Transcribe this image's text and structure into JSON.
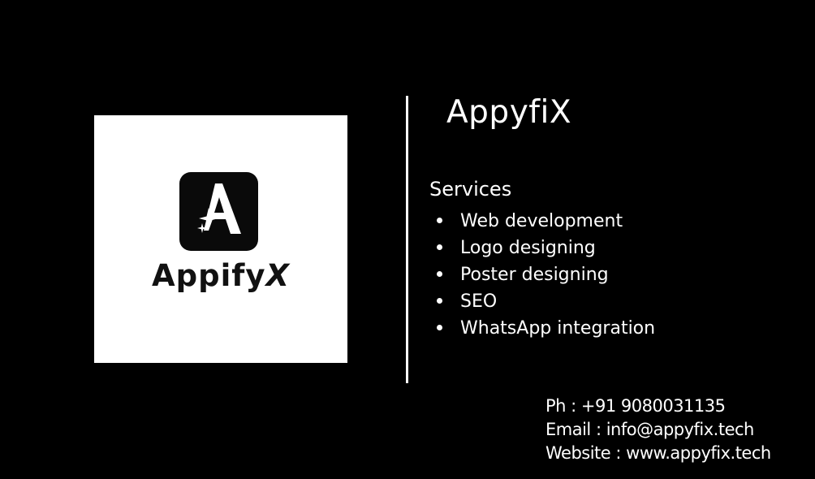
{
  "card": {
    "company_name": "AppyfiX",
    "background_color": "#000000",
    "text_color": "#ffffff"
  },
  "logo": {
    "wordmark_main": "Appify",
    "wordmark_x": "X",
    "tile_letter": "A",
    "icon": "sparkle-icon"
  },
  "services": {
    "heading": "Services",
    "items": [
      "Web development",
      "Logo designing",
      "Poster designing",
      "SEO",
      "WhatsApp integration"
    ]
  },
  "contact": {
    "phone": "Ph : +91 9080031135",
    "email": "Email : info@appyfix.tech",
    "website": "Website : www.appyfix.tech"
  }
}
